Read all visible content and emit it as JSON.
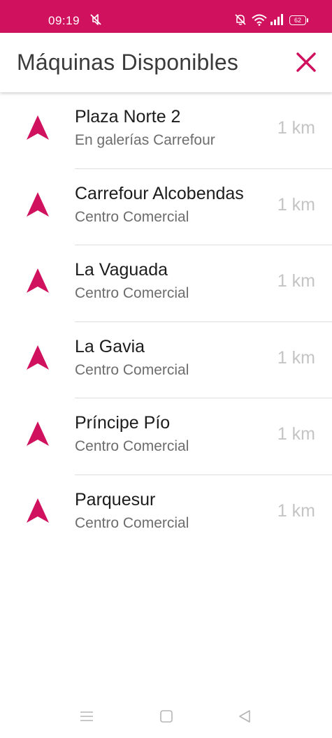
{
  "status_bar": {
    "time": "09:19",
    "battery": "62",
    "background_color": "#d0125e",
    "icons": [
      "mute-icon",
      "bell-off-icon",
      "wifi-icon",
      "signal-icon",
      "battery-icon"
    ]
  },
  "header": {
    "title": "Máquinas Disponibles",
    "close_icon": "close-icon",
    "accent_color": "#d0125e"
  },
  "locations": [
    {
      "name": "Plaza Norte 2",
      "subtitle": "En galerías Carrefour",
      "distance": "1 km"
    },
    {
      "name": "Carrefour Alcobendas",
      "subtitle": "Centro Comercial",
      "distance": "1 km"
    },
    {
      "name": "La Vaguada",
      "subtitle": "Centro Comercial",
      "distance": "1 km"
    },
    {
      "name": "La Gavia",
      "subtitle": "Centro Comercial",
      "distance": "1 km"
    },
    {
      "name": "Príncipe Pío",
      "subtitle": "Centro Comercial",
      "distance": "1 km"
    },
    {
      "name": "Parquesur",
      "subtitle": "Centro Comercial",
      "distance": "1 km"
    }
  ],
  "location_icon": "navigation-arrow-icon",
  "nav_bar": {
    "icons": [
      "menu-icon",
      "home-icon",
      "back-icon"
    ]
  }
}
